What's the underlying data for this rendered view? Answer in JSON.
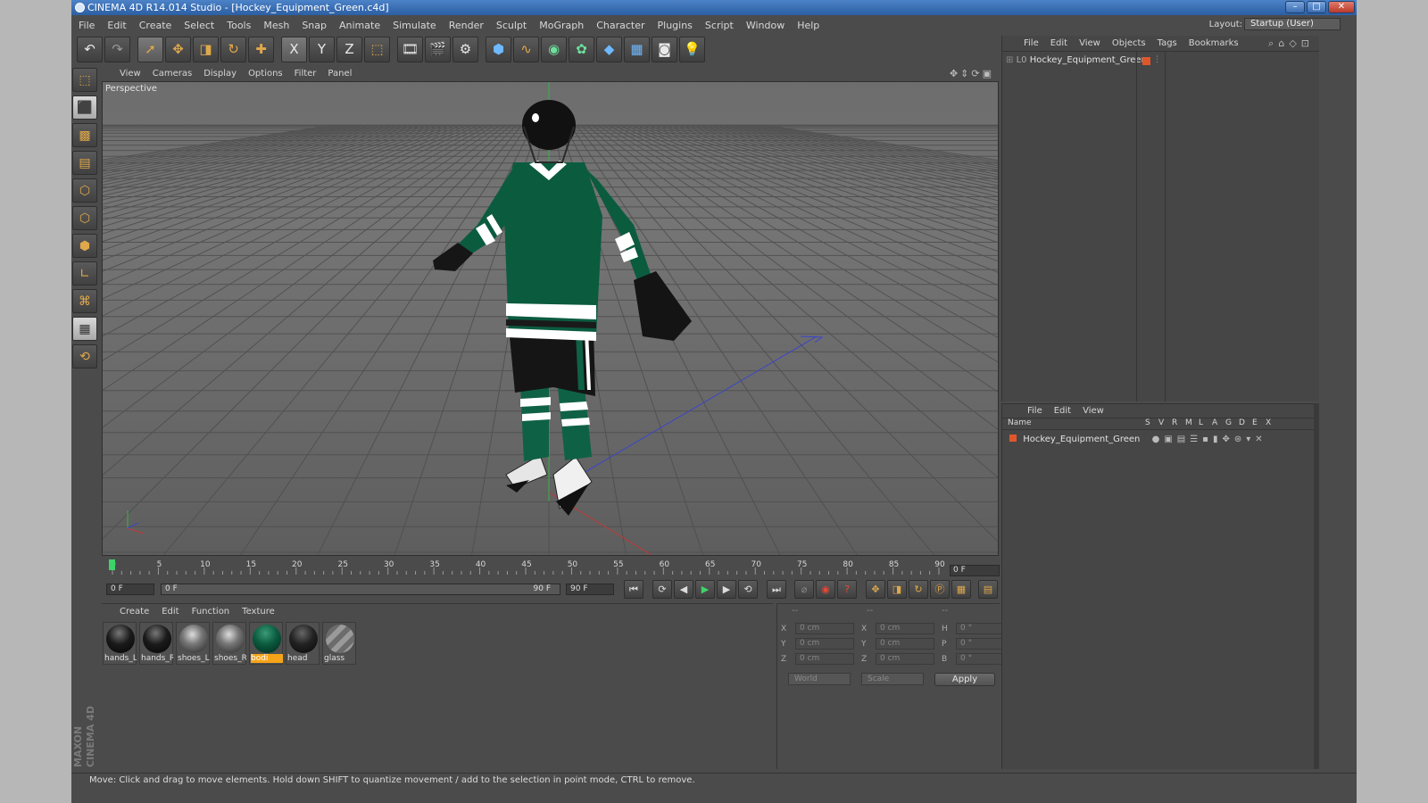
{
  "window": {
    "title": "CINEMA 4D R14.014 Studio - [Hockey_Equipment_Green.c4d]",
    "controls": [
      "–",
      "□",
      "✕"
    ]
  },
  "menubar": [
    "File",
    "Edit",
    "Create",
    "Select",
    "Tools",
    "Mesh",
    "Snap",
    "Animate",
    "Simulate",
    "Render",
    "Sculpt",
    "MoGraph",
    "Character",
    "Plugins",
    "Script",
    "Window",
    "Help"
  ],
  "layout": {
    "label": "Layout:",
    "value": "Startup (User)"
  },
  "toolbar": {
    "icons": [
      "undo-icon",
      "redo-icon",
      "select-icon",
      "move-icon",
      "scale-icon",
      "rotate-icon",
      "live-select-icon",
      "x-axis-icon",
      "y-axis-icon",
      "z-axis-icon",
      "coordinate-system-icon",
      "render-view-icon",
      "render-picture-viewer-icon",
      "render-settings-icon",
      "cube-icon",
      "spline-icon",
      "nurbs-icon",
      "array-icon",
      "deformer-icon",
      "floor-icon",
      "camera-icon",
      "light-icon"
    ],
    "axis_labels": [
      "X",
      "Y",
      "Z"
    ]
  },
  "viewport": {
    "menu": [
      "View",
      "Cameras",
      "Display",
      "Options",
      "Filter",
      "Panel"
    ],
    "label": "Perspective"
  },
  "timeline": {
    "ticks": [
      "0",
      "5",
      "10",
      "15",
      "20",
      "25",
      "30",
      "35",
      "40",
      "45",
      "50",
      "55",
      "60",
      "65",
      "70",
      "75",
      "80",
      "85",
      "90"
    ],
    "current_frame": "0 F",
    "start_field": "0 F",
    "range_start": "0 F",
    "range_end": "90 F",
    "end_field": "90 F"
  },
  "materials": {
    "menu": [
      "Create",
      "Edit",
      "Function",
      "Texture"
    ],
    "items": [
      {
        "label": "hands_L",
        "color": "#1a1a1a"
      },
      {
        "label": "hands_R",
        "color": "#1a1a1a"
      },
      {
        "label": "shoes_L",
        "color": "#777777"
      },
      {
        "label": "shoes_R",
        "color": "#777777"
      },
      {
        "label": "bodi",
        "color": "#0b5b3f",
        "selected": true
      },
      {
        "label": "head",
        "color": "#222222"
      },
      {
        "label": "glass",
        "color": "#8a8a8a"
      }
    ]
  },
  "coordinates": {
    "header": [
      "--",
      "--",
      "--"
    ],
    "rows": [
      {
        "a": "X",
        "av": "0 cm",
        "b": "X",
        "bv": "0 cm",
        "c": "H",
        "cv": "0 °"
      },
      {
        "a": "Y",
        "av": "0 cm",
        "b": "Y",
        "bv": "0 cm",
        "c": "P",
        "cv": "0 °"
      },
      {
        "a": "Z",
        "av": "0 cm",
        "b": "Z",
        "bv": "0 cm",
        "c": "B",
        "cv": "0 °"
      }
    ],
    "world": "World",
    "scale": "Scale",
    "apply": "Apply"
  },
  "object_manager": {
    "menu": [
      "File",
      "Edit",
      "View",
      "Objects",
      "Tags",
      "Bookmarks"
    ],
    "object": "Hockey_Equipment_Green"
  },
  "attribute_manager": {
    "menu": [
      "File",
      "Edit",
      "View"
    ],
    "columns": [
      "Name",
      "S",
      "V",
      "R",
      "M",
      "L",
      "A",
      "G",
      "D",
      "E",
      "X"
    ],
    "object": "Hockey_Equipment_Green"
  },
  "status": "Move: Click and drag to move elements. Hold down SHIFT to quantize movement / add to the selection in point mode, CTRL to remove.",
  "branding": "MAXON CINEMA 4D",
  "colors": {
    "accent": "#f5a318",
    "title_blue": "#2c5fa3",
    "jersey_green": "#0b5b3f"
  }
}
